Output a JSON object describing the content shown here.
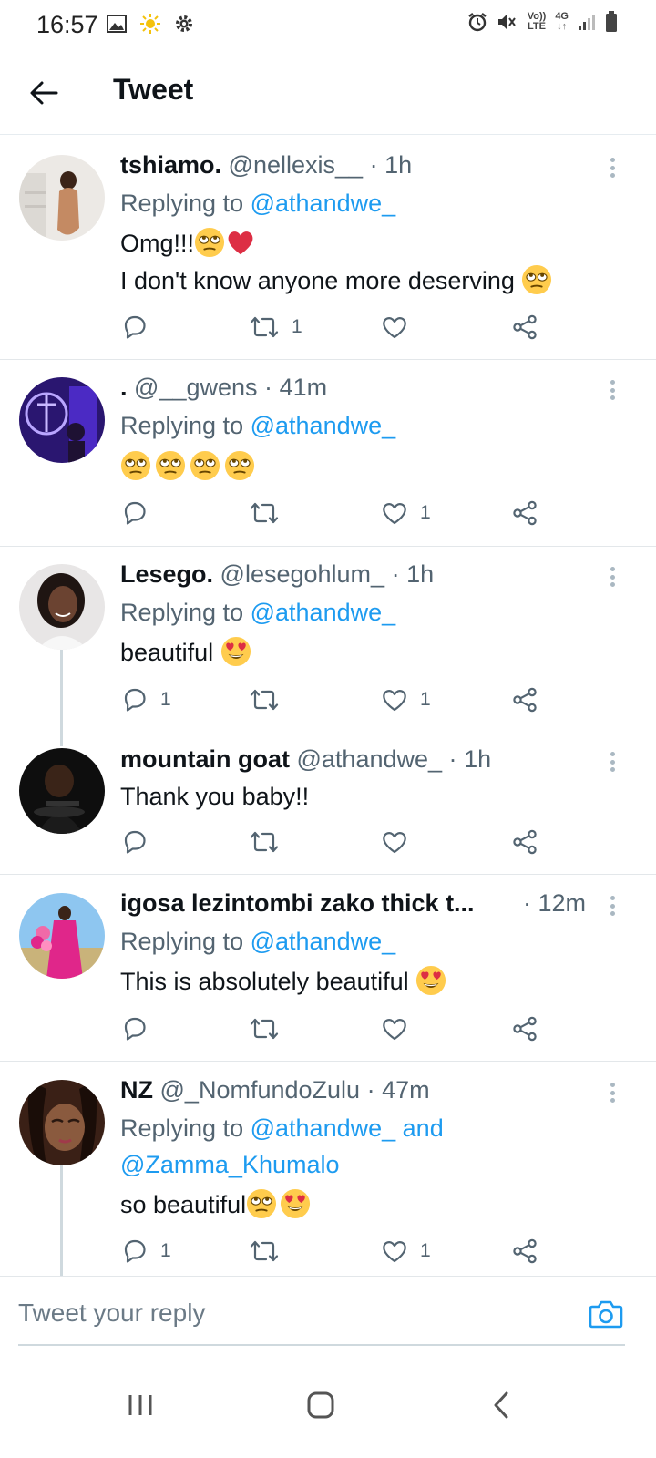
{
  "status_bar": {
    "time": "16:57",
    "left_icons": [
      "image-icon",
      "sun-icon",
      "gear-icon"
    ],
    "right_icons": [
      "alarm-icon",
      "mute-icon",
      "volte-icon",
      "network-4g-icon",
      "signal-icon",
      "battery-icon"
    ],
    "volte_top": "Vo))",
    "volte_bottom": "LTE",
    "net_top": "4G",
    "net_bottom": "↓↑"
  },
  "header": {
    "back_icon": "arrow-left-icon",
    "title": "Tweet"
  },
  "tweets": [
    {
      "name": "tshiamo.",
      "handle": "@nellexis__",
      "time": "1h",
      "replying_prefix": "Replying to",
      "replying_to": "@athandwe_",
      "lines": [
        "Omg!!!",
        "I don't know anyone more deserving"
      ],
      "emojis": [
        "face-with-rolling-eyes",
        "red-heart",
        "face-with-rolling-eyes"
      ],
      "reply_count": "",
      "retweet_count": "1",
      "like_count": ""
    },
    {
      "name": ".",
      "handle": "@__gwens",
      "time": "41m",
      "replying_prefix": "Replying to",
      "replying_to": "@athandwe_",
      "lines": [
        ""
      ],
      "emojis": [
        "face-with-rolling-eyes",
        "face-with-rolling-eyes",
        "face-with-rolling-eyes",
        "face-with-rolling-eyes"
      ],
      "reply_count": "",
      "retweet_count": "",
      "like_count": "1"
    },
    {
      "name": "Lesego.",
      "handle": "@lesegohlum_",
      "time": "1h",
      "replying_prefix": "Replying to",
      "replying_to": "@athandwe_",
      "lines": [
        "beautiful"
      ],
      "emojis": [
        "smiling-face-with-heart-eyes"
      ],
      "reply_count": "1",
      "retweet_count": "",
      "like_count": "1"
    },
    {
      "name": "mountain goat",
      "handle": "@athandwe_",
      "time": "1h",
      "lines": [
        "Thank you baby!!"
      ],
      "reply_count": "",
      "retweet_count": "",
      "like_count": ""
    },
    {
      "name": "igosa lezintombi zako thick t...",
      "handle": "",
      "time": "12m",
      "replying_prefix": "Replying to",
      "replying_to": "@athandwe_",
      "lines": [
        "This is absolutely beautiful"
      ],
      "emojis": [
        "smiling-face-with-heart-eyes"
      ],
      "reply_count": "",
      "retweet_count": "",
      "like_count": ""
    },
    {
      "name": "NZ",
      "handle": "@_NomfundoZulu",
      "time": "47m",
      "replying_prefix": "Replying to",
      "replying_to": "@athandwe_",
      "replying_and": "and",
      "replying_to_2": "@Zamma_Khumalo",
      "lines": [
        "so beautiful"
      ],
      "emojis": [
        "face-with-rolling-eyes",
        "smiling-face-with-heart-eyes"
      ],
      "reply_count": "1",
      "retweet_count": "",
      "like_count": "1"
    }
  ],
  "separator": "·",
  "reply_bar": {
    "placeholder": "Tweet your reply",
    "camera_icon": "camera-icon"
  },
  "nav_bar": {
    "icons": [
      "recent-apps-icon",
      "home-icon",
      "back-icon"
    ]
  },
  "colors": {
    "link": "#1d9bf0",
    "secondary_text": "#536471",
    "heart_red": "#e0245e",
    "emoji_yellow": "#ffcc4d"
  }
}
